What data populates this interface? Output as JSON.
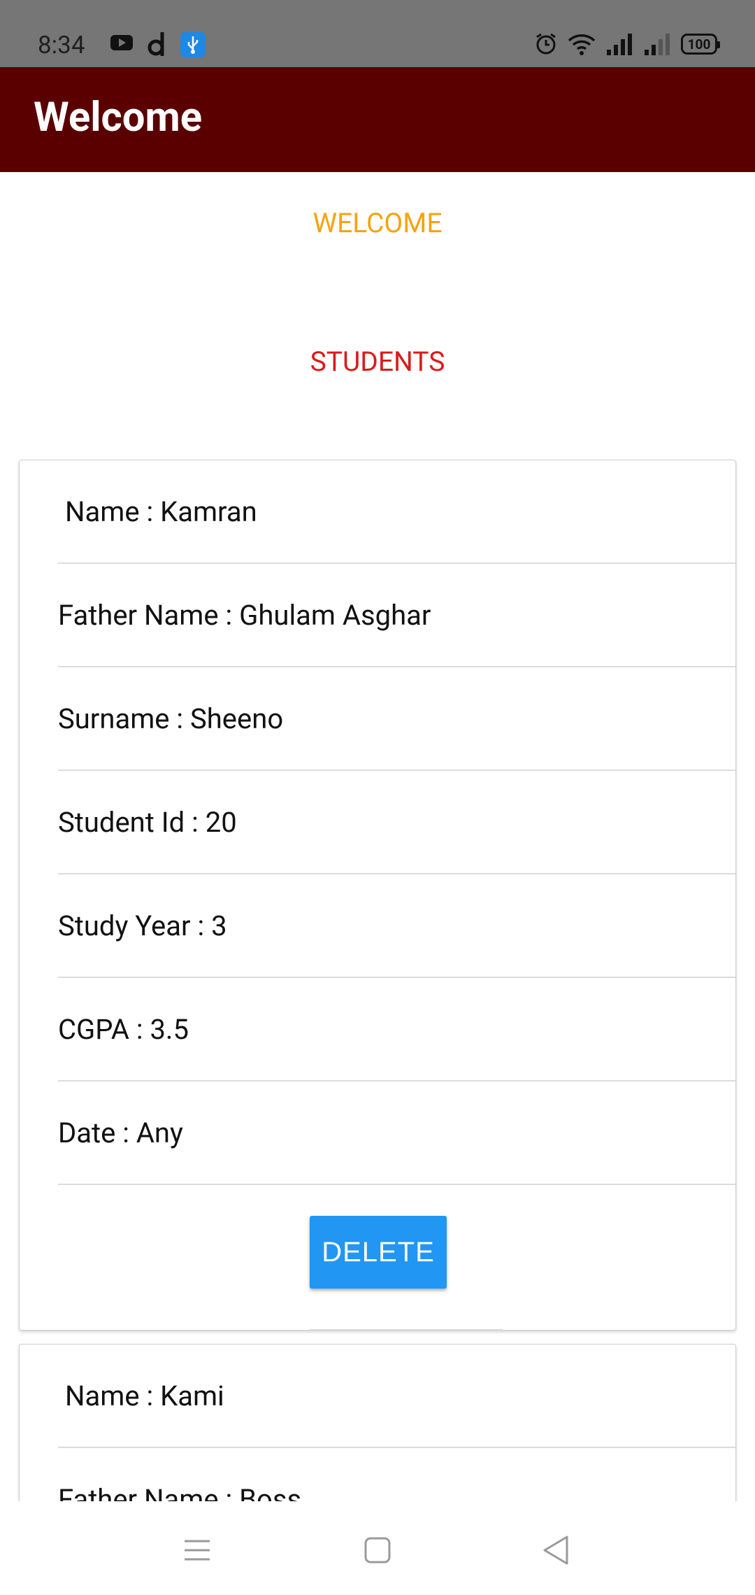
{
  "status_bar": {
    "time": "8:34",
    "battery": "100",
    "icons": [
      "youtube-icon",
      "d-app-icon",
      "usb-icon",
      "alarm-icon",
      "wifi-icon",
      "signal-icon",
      "signal-icon-2",
      "battery-icon"
    ]
  },
  "app_bar": {
    "title": "Welcome"
  },
  "headings": {
    "welcome": "WELCOME",
    "students": "STUDENTS"
  },
  "students": [
    {
      "rows": [
        "Name : Kamran",
        "Father Name : Ghulam Asghar",
        "Surname : Sheeno",
        "Student Id : 20",
        "Study Year : 3",
        "CGPA : 3.5",
        "Date : Any"
      ],
      "delete_label": "DELETE"
    },
    {
      "rows": [
        "Name : Kami",
        "Father Name : Boss"
      ]
    }
  ],
  "nav_bar": {
    "icons": [
      "menu-icon",
      "home-icon",
      "back-icon"
    ]
  }
}
